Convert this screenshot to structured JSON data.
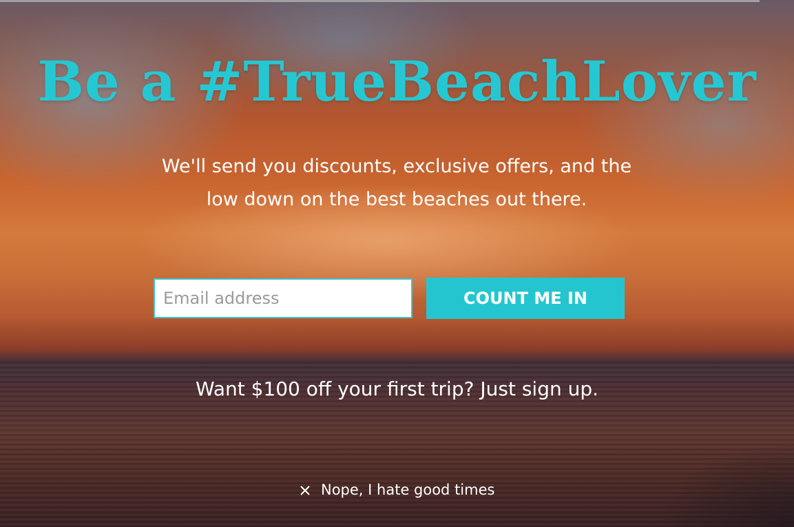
{
  "modal": {
    "title": "Be a #TrueBeachLover",
    "subtitle": "We'll send you discounts, exclusive offers, and the low down on the best beaches out there.",
    "email_placeholder": "Email address",
    "cta_label": "COUNT ME IN",
    "promo_text": "Want $100 off your first trip? Just sign up.",
    "dismiss_label": "Nope, I hate good times",
    "dismiss_icon": "close-icon"
  },
  "colors": {
    "accent": "#25c5d0",
    "text": "#ffffff"
  }
}
